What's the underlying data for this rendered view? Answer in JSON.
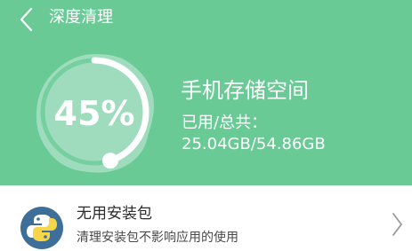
{
  "header": {
    "title": "深度清理"
  },
  "storage": {
    "percent_text": "45%",
    "used_fraction": 0.45,
    "title": "手机存储空间",
    "label": "已用/总共：",
    "value": "25.04GB/54.86GB"
  },
  "list": {
    "items": [
      {
        "title": "无用安装包",
        "subtitle": "清理安装包不影响应用的使用",
        "icon": "python-icon"
      }
    ]
  },
  "colors": {
    "header_bg": "#69ca96",
    "white": "#ffffff",
    "text_primary": "#2b2b2b",
    "text_secondary": "#4a4a4a",
    "chevron": "#9a9a9a",
    "icon_bg": "#3e6f98"
  }
}
